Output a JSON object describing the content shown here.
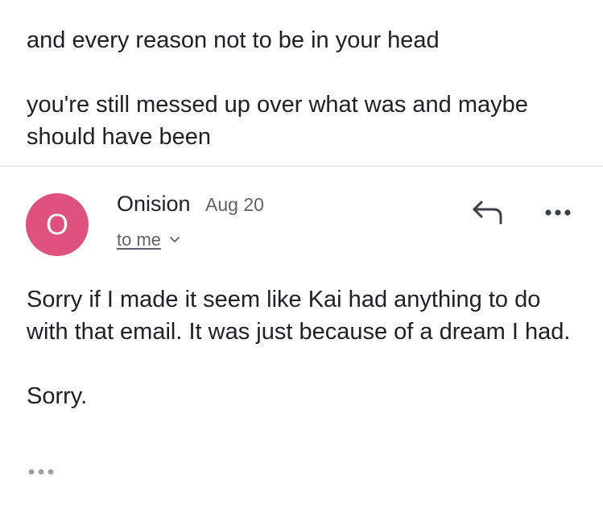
{
  "previous_message": {
    "line1": "and every reason not to be in your head",
    "line2": "you're still messed up over what was and maybe should have been"
  },
  "email": {
    "avatar_initial": "O",
    "avatar_color": "#e0527e",
    "sender_name": "Onision",
    "date": "Aug 20",
    "recipient": "to me",
    "recipient_icon": "chevron-down-icon",
    "reply_icon": "reply-icon",
    "more_icon": "more-options-icon",
    "body_paragraph1": "Sorry  if I made it seem like Kai had anything to do with that email. It was just because of a dream I had.",
    "body_paragraph2": "Sorry.",
    "trimmed_icon": "show-trimmed-content-icon"
  }
}
